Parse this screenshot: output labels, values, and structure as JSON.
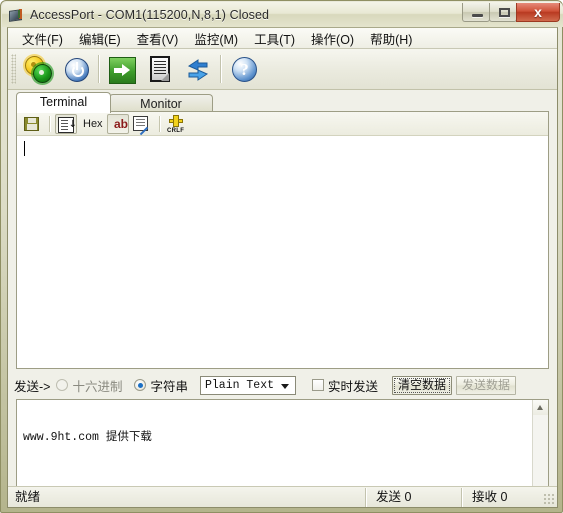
{
  "window": {
    "title": "AccessPort - COM1(115200,N,8,1) Closed",
    "icon": "serial-port-icon",
    "minimize_label": "",
    "maximize_label": "",
    "close_label": "x"
  },
  "menubar": {
    "items": [
      {
        "label": "文件(F)",
        "name": "menu-file"
      },
      {
        "label": "编辑(E)",
        "name": "menu-edit"
      },
      {
        "label": "查看(V)",
        "name": "menu-view"
      },
      {
        "label": "监控(M)",
        "name": "menu-monitor"
      },
      {
        "label": "工具(T)",
        "name": "menu-tools"
      },
      {
        "label": "操作(O)",
        "name": "menu-operate"
      },
      {
        "label": "帮助(H)",
        "name": "menu-help"
      }
    ]
  },
  "toolbar": {
    "buttons": [
      {
        "name": "config-gears-icon",
        "title": "配置"
      },
      {
        "name": "power-icon",
        "title": "开关"
      },
      {
        "name": "green-arrow-icon",
        "title": "打开"
      },
      {
        "name": "document-icon",
        "title": "文档"
      },
      {
        "name": "sync-arrows-icon",
        "title": "刷新"
      },
      {
        "name": "help-icon",
        "title": "帮助",
        "glyph": "?"
      }
    ]
  },
  "tabs": [
    {
      "label": "Terminal",
      "active": true
    },
    {
      "label": "Monitor",
      "active": false
    }
  ],
  "terminal": {
    "subtoolbar": {
      "save": {
        "name": "save-icon"
      },
      "list": {
        "name": "list-icon",
        "arrow": "↓"
      },
      "hex": {
        "label": "Hex"
      },
      "ab": {
        "label": "ab",
        "pressed": true
      },
      "checklist": {
        "name": "checklist-edit-icon"
      },
      "crlf": {
        "label": "CRLF"
      }
    },
    "content": ""
  },
  "sendbar": {
    "label": "发送->",
    "radio_hex": {
      "label": "十六进制",
      "checked": false
    },
    "radio_string": {
      "label": "字符串",
      "checked": true
    },
    "format_combo": {
      "value": "Plain Text"
    },
    "realtime_check": {
      "label": "实时发送",
      "checked": false
    },
    "clear_button": {
      "label": "清空数据"
    },
    "send_button": {
      "label": "发送数据",
      "disabled": true
    }
  },
  "send_area": {
    "text": "www.9ht.com 提供下载"
  },
  "statusbar": {
    "ready": "就绪",
    "sent": "发送 0",
    "received": "接收 0"
  },
  "colors": {
    "frame": "#b4b48c",
    "close_button": "#cf5238",
    "accent_blue": "#1b6fc4",
    "ab_red": "#8b1a1a"
  }
}
